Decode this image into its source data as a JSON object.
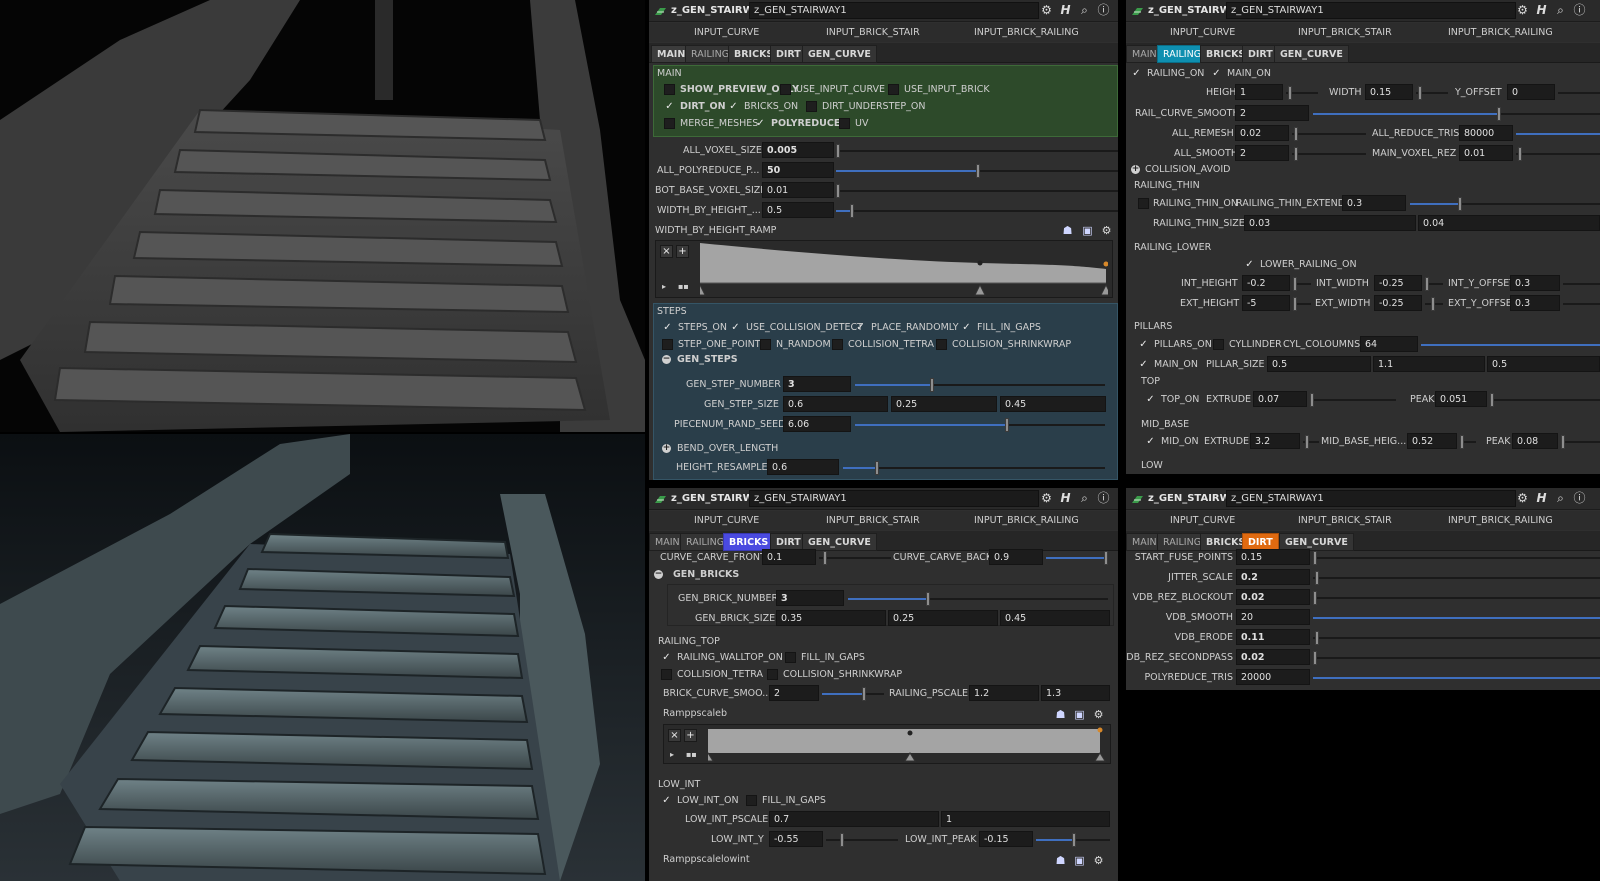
{
  "node": {
    "type": "z_GEN_STAIRWAY",
    "name": "z_GEN_STAIRWAY1"
  },
  "inputs": [
    "INPUT_CURVE",
    "INPUT_BRICK_STAIR",
    "INPUT_BRICK_RAILING"
  ],
  "tabs": [
    "MAIN",
    "RAILING",
    "BRICKS",
    "DIRT",
    "GEN_CURVE"
  ],
  "toolbar_icons": [
    "gear-icon",
    "help-icon",
    "search-icon",
    "info-icon"
  ],
  "colors": {
    "main_section": "#2d4a2a",
    "steps_section": "#2a3e4a",
    "railing_tab": "#0e8fb0",
    "bricks_tab": "#4a4ae0",
    "dirt_tab": "#e06a10",
    "slider_fill": "#3f6fbf"
  },
  "main_panel": {
    "section_main": "MAIN",
    "checks": [
      {
        "label": "SHOW_PREVIEW_ONLY",
        "checked": false,
        "bold": true
      },
      {
        "label": "USE_INPUT_CURVE",
        "checked": false
      },
      {
        "label": "USE_INPUT_BRICK",
        "checked": false
      },
      {
        "label": "DIRT_ON",
        "checked": true,
        "bold": true
      },
      {
        "label": "BRICKS_ON",
        "checked": true
      },
      {
        "label": "DIRT_UNDERSTEP_ON",
        "checked": false
      },
      {
        "label": "MERGE_MESHES",
        "checked": false
      },
      {
        "label": "POLYREDUCE",
        "checked": true,
        "bold": true
      },
      {
        "label": "UV",
        "checked": false
      }
    ],
    "params": [
      {
        "label": "ALL_VOXEL_SIZE",
        "value": "0.005",
        "fill": 0.0
      },
      {
        "label": "ALL_POLYREDUCE_P...",
        "value": "50",
        "fill": 0.5
      },
      {
        "label": "BOT_BASE_VOXEL_SIZE",
        "value": "0.01",
        "fill": 0.0
      },
      {
        "label": "WIDTH_BY_HEIGHT_...",
        "value": "0.5",
        "fill": 0.05
      }
    ],
    "ramp_label": "WIDTH_BY_HEIGHT_RAMP",
    "section_steps": "STEPS",
    "steps_checks": [
      {
        "label": "STEPS_ON",
        "checked": true
      },
      {
        "label": "USE_COLLISION_DETECT",
        "checked": true
      },
      {
        "label": "PLACE_RANDOMLY",
        "checked": true
      },
      {
        "label": "FILL_IN_GAPS",
        "checked": true
      },
      {
        "label": "STEP_ONE_POINT",
        "checked": false
      },
      {
        "label": "N_RANDOM",
        "checked": false
      },
      {
        "label": "COLLISION_TETRA",
        "checked": false
      },
      {
        "label": "COLLISION_SHRINKWRAP",
        "checked": false
      }
    ],
    "gen_steps": "GEN_STEPS",
    "gen_step_number": {
      "label": "GEN_STEP_NUMBER",
      "value": "3"
    },
    "gen_step_size": {
      "label": "GEN_STEP_SIZE",
      "values": [
        "0.6",
        "0.25",
        "0.45"
      ]
    },
    "piecenum": {
      "label": "PIECENUM_RAND_SEED",
      "value": "6.06"
    },
    "bend": "BEND_OVER_LENGTH",
    "height_resample": {
      "label": "HEIGHT_RESAMPLE",
      "value": "0.6"
    }
  },
  "railing_panel": {
    "railing_on": "RAILING_ON",
    "main_on": "MAIN_ON",
    "height": {
      "label": "HEIGHT",
      "value": "1"
    },
    "width": {
      "label": "WIDTH",
      "value": "0.15"
    },
    "y_offset": {
      "label": "Y_OFFSET",
      "value": "0"
    },
    "rail_curve_smooth": {
      "label": "RAIL_CURVE_SMOOTH",
      "value": "2"
    },
    "all_remesh": {
      "label": "ALL_REMESH",
      "value": "0.02"
    },
    "all_reduce_tris": {
      "label": "ALL_REDUCE_TRIS",
      "value": "80000"
    },
    "all_smooth": {
      "label": "ALL_SMOOTH",
      "value": "2"
    },
    "main_voxel_rez": {
      "label": "MAIN_VOXEL_REZ",
      "value": "0.01"
    },
    "collision_avoid": "COLLISION_AVOID",
    "railing_thin": "RAILING_THIN",
    "railing_thin_on": "RAILING_THIN_ON",
    "railing_thin_extend": {
      "label": "RAILING_THIN_EXTEND",
      "value": "0.3"
    },
    "railing_thin_size": {
      "label": "RAILING_THIN_SIZE",
      "values": [
        "0.03",
        "0.04"
      ]
    },
    "railing_lower": "RAILING_LOWER",
    "lower_railing_on": "LOWER_RAILING_ON",
    "int_height": {
      "label": "INT_HEIGHT",
      "value": "-0.2"
    },
    "int_width": {
      "label": "INT_WIDTH",
      "value": "-0.25"
    },
    "int_y_offset": {
      "label": "INT_Y_OFFSET",
      "value": "0.3"
    },
    "ext_height": {
      "label": "EXT_HEIGHT",
      "value": "-5"
    },
    "ext_width": {
      "label": "EXT_WIDTH",
      "value": "-0.25"
    },
    "ext_y_offset": {
      "label": "EXT_Y_OFFSET",
      "value": "0.3"
    },
    "pillars": "PILLARS",
    "pillars_on": "PILLARS_ON",
    "cyllinder": "CYLLINDER",
    "cyl_coloumns": {
      "label": "CYL_COLOUMNS",
      "value": "64"
    },
    "main_on2": "MAIN_ON",
    "pillar_size": {
      "label": "PILLAR_SIZE",
      "values": [
        "0.5",
        "1.1",
        "0.5"
      ]
    },
    "top": "TOP",
    "top_on": "TOP_ON",
    "top_extrude": {
      "label": "EXTRUDE",
      "value": "0.07"
    },
    "top_peak": {
      "label": "PEAK",
      "value": "0.051"
    },
    "mid_base": "MID_BASE",
    "mid_on": "MID_ON",
    "mid_extrude": {
      "label": "EXTRUDE",
      "value": "3.2"
    },
    "mid_base_height": {
      "label": "MID_BASE_HEIG...",
      "value": "0.52"
    },
    "mid_peak": {
      "label": "PEAK",
      "value": "0.08"
    },
    "low": "LOW"
  },
  "bricks_panel": {
    "curve_carve_front": {
      "label": "CURVE_CARVE_FRONT",
      "value": "0.1"
    },
    "curve_carve_back": {
      "label": "CURVE_CARVE_BACK",
      "value": "0.9"
    },
    "gen_bricks": "GEN_BRICKS",
    "gen_brick_number": {
      "label": "GEN_BRICK_NUMBER",
      "value": "3"
    },
    "gen_brick_size": {
      "label": "GEN_BRICK_SIZE",
      "values": [
        "0.35",
        "0.25",
        "0.45"
      ]
    },
    "railing_top": "RAILING_TOP",
    "railing_walltop_on": "RAILING_WALLTOP_ON",
    "fill_in_gaps": "FILL_IN_GAPS",
    "collision_tetra": "COLLISION_TETRA",
    "collision_shrinkwrap": "COLLISION_SHRINKWRAP",
    "brick_curve_smooth": {
      "label": "BRICK_CURVE_SMOO...",
      "value": "2"
    },
    "railing_pscale": {
      "label": "RAILING_PSCALE",
      "values": [
        "1.2",
        "1.3"
      ]
    },
    "ramp_label": "Ramppscaleb",
    "low_int": "LOW_INT",
    "low_int_on": "LOW_INT_ON",
    "low_int_fill": "FILL_IN_GAPS",
    "low_int_pscale": {
      "label": "LOW_INT_PSCALE",
      "values": [
        "0.7",
        "1"
      ]
    },
    "low_int_y": {
      "label": "LOW_INT_Y",
      "value": "-0.55"
    },
    "low_int_peak": {
      "label": "LOW_INT_PEAK",
      "value": "-0.15"
    },
    "ramp2_label": "Ramppscalelowint"
  },
  "dirt_panel": {
    "params": [
      {
        "label": "START_FUSE_POINTS",
        "value": "0.15",
        "bold": false
      },
      {
        "label": "JITTER_SCALE",
        "value": "0.2",
        "bold": true
      },
      {
        "label": "VDB_REZ_BLOCKOUT",
        "value": "0.02",
        "bold": true
      },
      {
        "label": "VDB_SMOOTH",
        "value": "20",
        "bold": false
      },
      {
        "label": "VDB_ERODE",
        "value": "0.11",
        "bold": true
      },
      {
        "label": "VDB_REZ_SECONDPASS",
        "value": "0.02",
        "bold": true
      },
      {
        "label": "POLYREDUCE_TRIS",
        "value": "20000",
        "bold": false
      }
    ]
  }
}
